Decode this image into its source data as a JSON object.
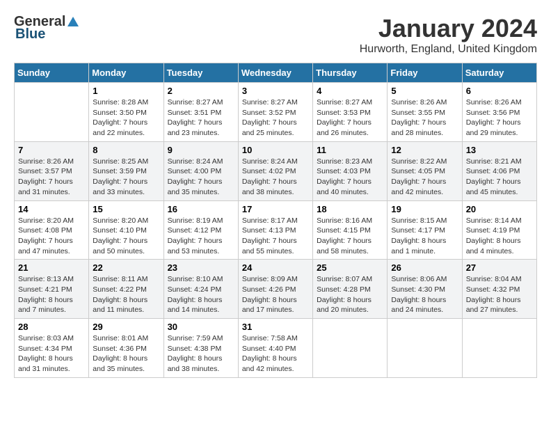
{
  "logo": {
    "general": "General",
    "blue": "Blue"
  },
  "title": "January 2024",
  "location": "Hurworth, England, United Kingdom",
  "days_of_week": [
    "Sunday",
    "Monday",
    "Tuesday",
    "Wednesday",
    "Thursday",
    "Friday",
    "Saturday"
  ],
  "weeks": [
    [
      {
        "day": "",
        "sunrise": "",
        "sunset": "",
        "daylight": ""
      },
      {
        "day": "1",
        "sunrise": "Sunrise: 8:28 AM",
        "sunset": "Sunset: 3:50 PM",
        "daylight": "Daylight: 7 hours and 22 minutes."
      },
      {
        "day": "2",
        "sunrise": "Sunrise: 8:27 AM",
        "sunset": "Sunset: 3:51 PM",
        "daylight": "Daylight: 7 hours and 23 minutes."
      },
      {
        "day": "3",
        "sunrise": "Sunrise: 8:27 AM",
        "sunset": "Sunset: 3:52 PM",
        "daylight": "Daylight: 7 hours and 25 minutes."
      },
      {
        "day": "4",
        "sunrise": "Sunrise: 8:27 AM",
        "sunset": "Sunset: 3:53 PM",
        "daylight": "Daylight: 7 hours and 26 minutes."
      },
      {
        "day": "5",
        "sunrise": "Sunrise: 8:26 AM",
        "sunset": "Sunset: 3:55 PM",
        "daylight": "Daylight: 7 hours and 28 minutes."
      },
      {
        "day": "6",
        "sunrise": "Sunrise: 8:26 AM",
        "sunset": "Sunset: 3:56 PM",
        "daylight": "Daylight: 7 hours and 29 minutes."
      }
    ],
    [
      {
        "day": "7",
        "sunrise": "Sunrise: 8:26 AM",
        "sunset": "Sunset: 3:57 PM",
        "daylight": "Daylight: 7 hours and 31 minutes."
      },
      {
        "day": "8",
        "sunrise": "Sunrise: 8:25 AM",
        "sunset": "Sunset: 3:59 PM",
        "daylight": "Daylight: 7 hours and 33 minutes."
      },
      {
        "day": "9",
        "sunrise": "Sunrise: 8:24 AM",
        "sunset": "Sunset: 4:00 PM",
        "daylight": "Daylight: 7 hours and 35 minutes."
      },
      {
        "day": "10",
        "sunrise": "Sunrise: 8:24 AM",
        "sunset": "Sunset: 4:02 PM",
        "daylight": "Daylight: 7 hours and 38 minutes."
      },
      {
        "day": "11",
        "sunrise": "Sunrise: 8:23 AM",
        "sunset": "Sunset: 4:03 PM",
        "daylight": "Daylight: 7 hours and 40 minutes."
      },
      {
        "day": "12",
        "sunrise": "Sunrise: 8:22 AM",
        "sunset": "Sunset: 4:05 PM",
        "daylight": "Daylight: 7 hours and 42 minutes."
      },
      {
        "day": "13",
        "sunrise": "Sunrise: 8:21 AM",
        "sunset": "Sunset: 4:06 PM",
        "daylight": "Daylight: 7 hours and 45 minutes."
      }
    ],
    [
      {
        "day": "14",
        "sunrise": "Sunrise: 8:20 AM",
        "sunset": "Sunset: 4:08 PM",
        "daylight": "Daylight: 7 hours and 47 minutes."
      },
      {
        "day": "15",
        "sunrise": "Sunrise: 8:20 AM",
        "sunset": "Sunset: 4:10 PM",
        "daylight": "Daylight: 7 hours and 50 minutes."
      },
      {
        "day": "16",
        "sunrise": "Sunrise: 8:19 AM",
        "sunset": "Sunset: 4:12 PM",
        "daylight": "Daylight: 7 hours and 53 minutes."
      },
      {
        "day": "17",
        "sunrise": "Sunrise: 8:17 AM",
        "sunset": "Sunset: 4:13 PM",
        "daylight": "Daylight: 7 hours and 55 minutes."
      },
      {
        "day": "18",
        "sunrise": "Sunrise: 8:16 AM",
        "sunset": "Sunset: 4:15 PM",
        "daylight": "Daylight: 7 hours and 58 minutes."
      },
      {
        "day": "19",
        "sunrise": "Sunrise: 8:15 AM",
        "sunset": "Sunset: 4:17 PM",
        "daylight": "Daylight: 8 hours and 1 minute."
      },
      {
        "day": "20",
        "sunrise": "Sunrise: 8:14 AM",
        "sunset": "Sunset: 4:19 PM",
        "daylight": "Daylight: 8 hours and 4 minutes."
      }
    ],
    [
      {
        "day": "21",
        "sunrise": "Sunrise: 8:13 AM",
        "sunset": "Sunset: 4:21 PM",
        "daylight": "Daylight: 8 hours and 7 minutes."
      },
      {
        "day": "22",
        "sunrise": "Sunrise: 8:11 AM",
        "sunset": "Sunset: 4:22 PM",
        "daylight": "Daylight: 8 hours and 11 minutes."
      },
      {
        "day": "23",
        "sunrise": "Sunrise: 8:10 AM",
        "sunset": "Sunset: 4:24 PM",
        "daylight": "Daylight: 8 hours and 14 minutes."
      },
      {
        "day": "24",
        "sunrise": "Sunrise: 8:09 AM",
        "sunset": "Sunset: 4:26 PM",
        "daylight": "Daylight: 8 hours and 17 minutes."
      },
      {
        "day": "25",
        "sunrise": "Sunrise: 8:07 AM",
        "sunset": "Sunset: 4:28 PM",
        "daylight": "Daylight: 8 hours and 20 minutes."
      },
      {
        "day": "26",
        "sunrise": "Sunrise: 8:06 AM",
        "sunset": "Sunset: 4:30 PM",
        "daylight": "Daylight: 8 hours and 24 minutes."
      },
      {
        "day": "27",
        "sunrise": "Sunrise: 8:04 AM",
        "sunset": "Sunset: 4:32 PM",
        "daylight": "Daylight: 8 hours and 27 minutes."
      }
    ],
    [
      {
        "day": "28",
        "sunrise": "Sunrise: 8:03 AM",
        "sunset": "Sunset: 4:34 PM",
        "daylight": "Daylight: 8 hours and 31 minutes."
      },
      {
        "day": "29",
        "sunrise": "Sunrise: 8:01 AM",
        "sunset": "Sunset: 4:36 PM",
        "daylight": "Daylight: 8 hours and 35 minutes."
      },
      {
        "day": "30",
        "sunrise": "Sunrise: 7:59 AM",
        "sunset": "Sunset: 4:38 PM",
        "daylight": "Daylight: 8 hours and 38 minutes."
      },
      {
        "day": "31",
        "sunrise": "Sunrise: 7:58 AM",
        "sunset": "Sunset: 4:40 PM",
        "daylight": "Daylight: 8 hours and 42 minutes."
      },
      {
        "day": "",
        "sunrise": "",
        "sunset": "",
        "daylight": ""
      },
      {
        "day": "",
        "sunrise": "",
        "sunset": "",
        "daylight": ""
      },
      {
        "day": "",
        "sunrise": "",
        "sunset": "",
        "daylight": ""
      }
    ]
  ]
}
